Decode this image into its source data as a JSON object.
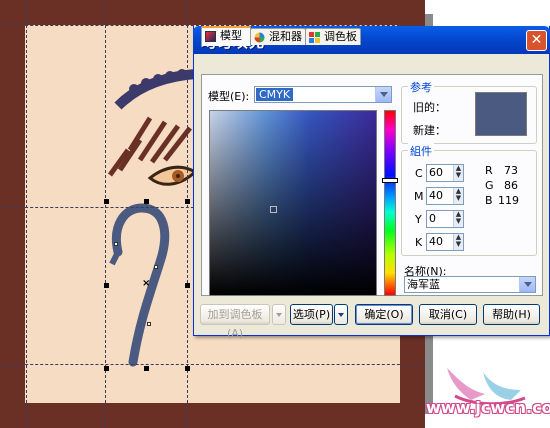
{
  "dialog": {
    "title": "均匀填充",
    "close_symbol": "✕"
  },
  "tabs": [
    {
      "label": "模型",
      "icon": "model-icon"
    },
    {
      "label": "混和器",
      "icon": "mixer-icon"
    },
    {
      "label": "调色板",
      "icon": "palette-icon"
    }
  ],
  "model": {
    "label": "模型(E):",
    "value": "CMYK"
  },
  "reference": {
    "title": "参考",
    "old_label": "旧的：",
    "new_label": "新建：",
    "old_color": "#4a5a80"
  },
  "components": {
    "title": "組件",
    "cmyk": [
      {
        "label": "C",
        "value": "60"
      },
      {
        "label": "M",
        "value": "40"
      },
      {
        "label": "Y",
        "value": "0"
      },
      {
        "label": "K",
        "value": "40"
      }
    ],
    "rgb": [
      {
        "label": "R",
        "value": "73"
      },
      {
        "label": "G",
        "value": "86"
      },
      {
        "label": "B",
        "value": "119"
      }
    ]
  },
  "name": {
    "label": "名称(N):",
    "value": "海军蓝"
  },
  "buttons": {
    "add_to_palette": "加到调色板(A)",
    "options": "选项(P)",
    "ok": "确定(O)",
    "cancel": "取消(C)",
    "help": "帮助(H)"
  },
  "watermark": {
    "text": "www.jcwcn.com"
  },
  "colors": {
    "page_border": "#6a3026",
    "page_fill": "#f5dcc2",
    "figure_blue": "#4a5a80",
    "titlebar": "#0548d0"
  }
}
